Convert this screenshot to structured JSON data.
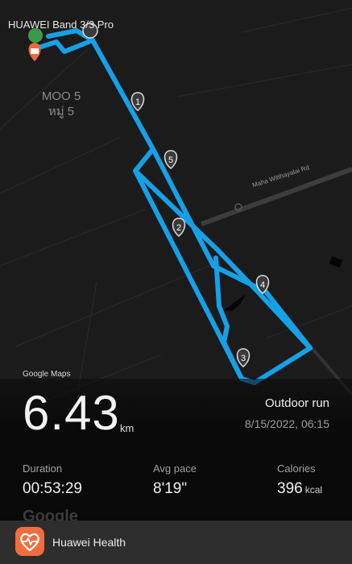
{
  "device_title": "HUAWEI Band 3/3 Pro",
  "map": {
    "village_name_en": "MOO 5",
    "village_name_th": "หมู่ 5",
    "road_name": "Maha Witthayalai Rd",
    "attribution": "Google Maps",
    "watermark": "Google",
    "km_markers": [
      "1",
      "2",
      "3",
      "4",
      "5"
    ],
    "route_color": "#1aa3e8",
    "start_marker_color": "#e86a3c",
    "end_marker_color": "#3a9a4a"
  },
  "summary": {
    "distance": "6.43",
    "distance_unit": "km",
    "activity_type": "Outdoor run",
    "datetime": "8/15/2022, 06:15"
  },
  "stats": {
    "duration": {
      "label": "Duration",
      "value": "00:53:29"
    },
    "avg_pace": {
      "label": "Avg pace",
      "value": "8'19\""
    },
    "calories": {
      "label": "Calories",
      "value": "396",
      "unit": "kcal"
    }
  },
  "share_bar": {
    "app_name": "Huawei Health",
    "app_icon": "heart-health-icon",
    "accent_color": "#f26d3d"
  }
}
